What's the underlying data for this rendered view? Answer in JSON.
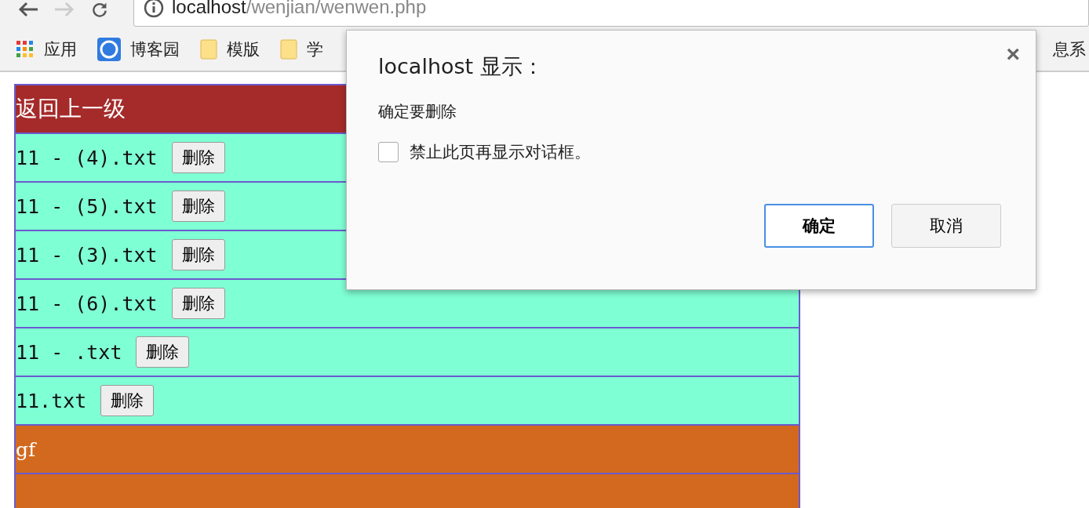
{
  "browser": {
    "url_host": "localhost",
    "url_path": "/wenjian/wenwen.php"
  },
  "bookmarks": [
    {
      "kind": "apps",
      "label": "应用"
    },
    {
      "kind": "site",
      "label": "博客园"
    },
    {
      "kind": "folder",
      "label": "模版"
    },
    {
      "kind": "folder",
      "label": "学"
    },
    {
      "kind": "text",
      "label": "息系"
    }
  ],
  "rows": [
    {
      "kind": "back",
      "name": "返回上一级"
    },
    {
      "kind": "file",
      "name": "11 - (4).txt",
      "button": "删除"
    },
    {
      "kind": "file",
      "name": "11 - (5).txt",
      "button": "删除"
    },
    {
      "kind": "file",
      "name": "11 - (3).txt",
      "button": "删除"
    },
    {
      "kind": "file",
      "name": "11 - (6).txt",
      "button": "删除"
    },
    {
      "kind": "file",
      "name": "11 - .txt",
      "button": "删除"
    },
    {
      "kind": "file",
      "name": "11.txt",
      "button": "删除"
    },
    {
      "kind": "folder",
      "name": "gf"
    },
    {
      "kind": "folder"
    }
  ],
  "dialog": {
    "title": "localhost 显示：",
    "message": "确定要删除",
    "checkbox": {
      "label": "禁止此页再显示对话框。",
      "checked": false
    },
    "close": "×",
    "buttons": [
      {
        "label": "确定",
        "focused": true
      },
      {
        "label": "取消",
        "focused": false
      }
    ]
  }
}
